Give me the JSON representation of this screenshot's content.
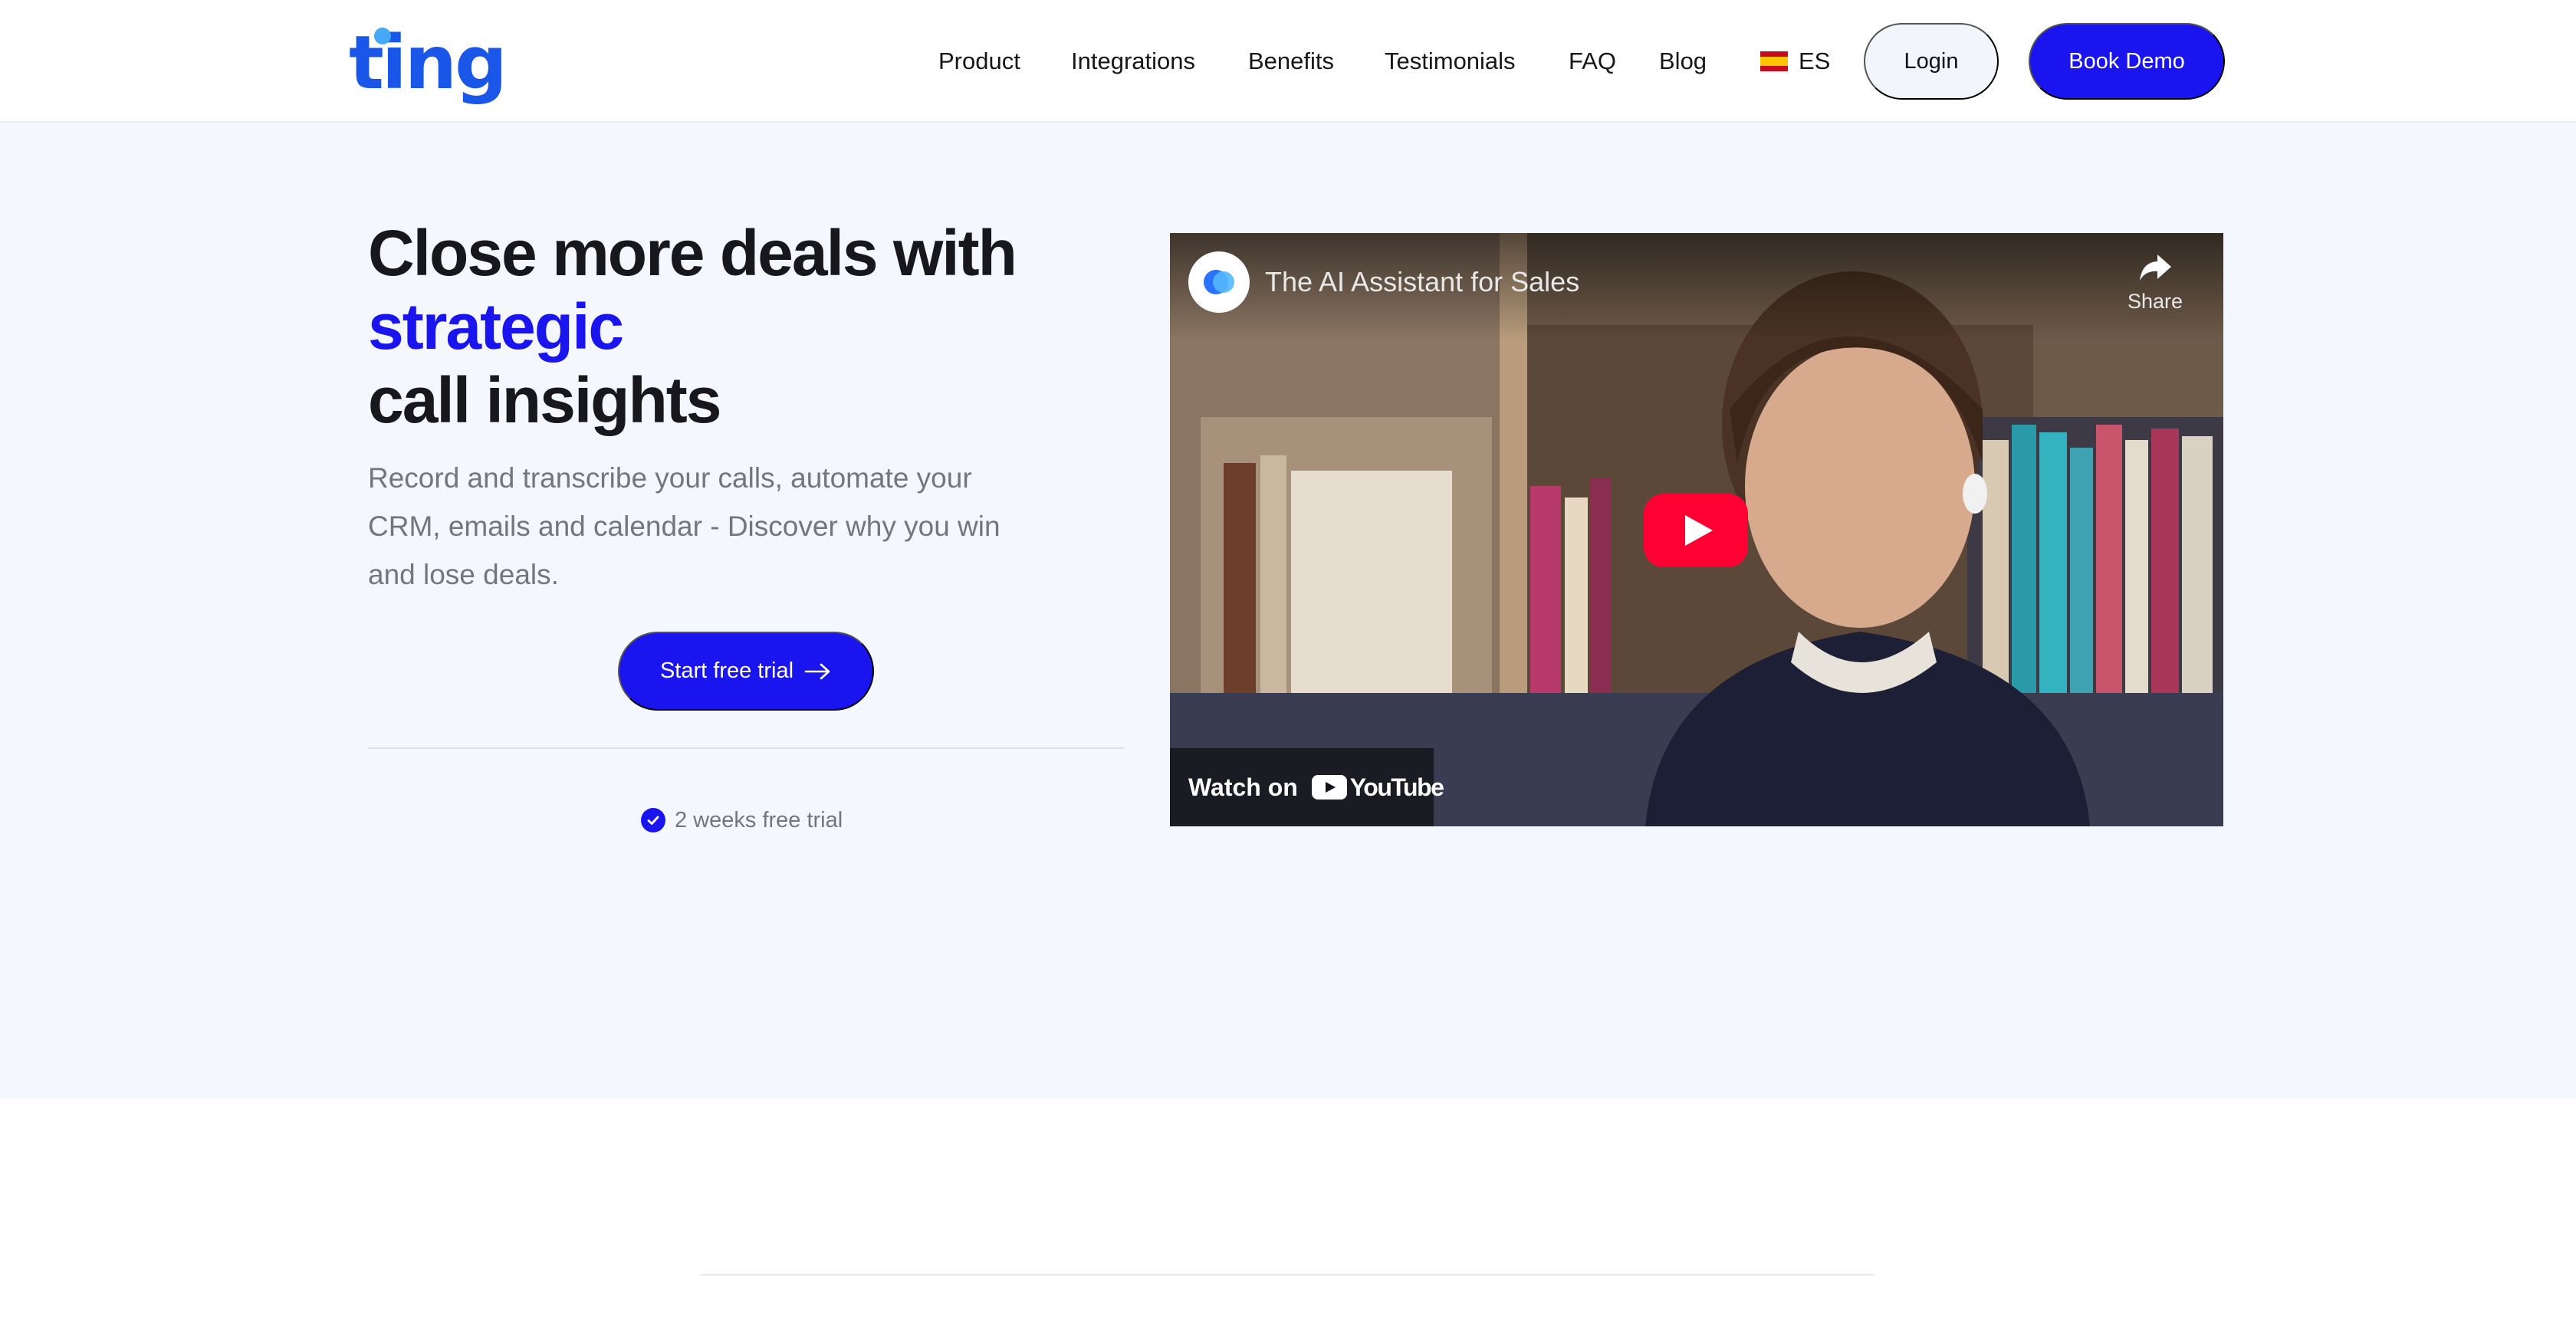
{
  "header": {
    "logo_text": "ting",
    "nav": [
      {
        "label": "Product"
      },
      {
        "label": "Integrations"
      },
      {
        "label": "Benefits"
      },
      {
        "label": "Testimonials"
      },
      {
        "label": "FAQ"
      },
      {
        "label": "Blog"
      }
    ],
    "language": {
      "label": "ES",
      "flag_icon": "spain-flag-icon"
    },
    "login_label": "Login",
    "book_demo_label": "Book Demo"
  },
  "hero": {
    "headline_line1": "Close more deals with",
    "headline_accent": "strategic",
    "headline_line3": "call insights",
    "subtext": "Record and transcribe your calls, automate your CRM, emails and calendar - Discover why you win and lose deals.",
    "cta_label": "Start free trial",
    "cta_icon": "arrow-right-icon",
    "trial_note": "2 weeks free trial",
    "trial_icon": "check-circle-icon"
  },
  "video": {
    "title": "The AI Assistant for Sales",
    "share_label": "Share",
    "watch_on_label": "Watch on",
    "youtube_label": "YouTube",
    "play_icon": "play-button-icon"
  },
  "colors": {
    "brand_blue": "#1a14ef",
    "logo_blue": "#1a56e8",
    "hero_bg": "#f4f7fd",
    "youtube_red": "#ff0033"
  }
}
